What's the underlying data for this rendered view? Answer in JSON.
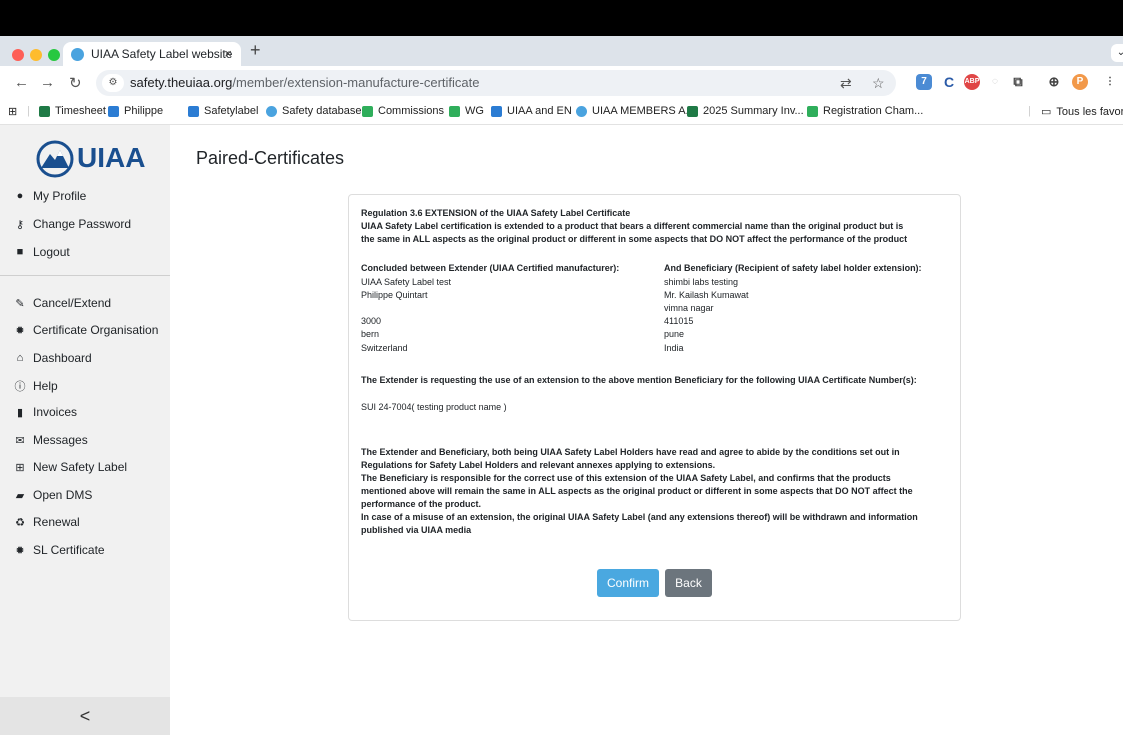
{
  "browser": {
    "tab_title": "UIAA Safety Label website",
    "tab_close": "×",
    "new_tab": "+",
    "url_host": "safety.theuiaa.org",
    "url_path": "/member/extension-manufacture-certificate",
    "profile_initial": "P",
    "bookmarks": [
      "Timesheet",
      "Philippe",
      "Safetylabel",
      "Safety database",
      "Commissions",
      "WG",
      "UIAA and EN",
      "UIAA MEMBERS A...",
      "2025 Summary Inv...",
      "Registration Cham..."
    ],
    "all_bookmarks": "Tous les favoris",
    "colors": {
      "tabbar": "#dde3ea",
      "accent": "#4aa8e0"
    }
  },
  "sidebar": {
    "logo_text": "UIAA",
    "account_items": [
      {
        "label": "My Profile",
        "icon": "user-icon"
      },
      {
        "label": "Change Password",
        "icon": "key-icon"
      },
      {
        "label": "Logout",
        "icon": "lock-icon"
      }
    ],
    "nav_items": [
      {
        "label": "Cancel/Extend",
        "icon": "edit-icon"
      },
      {
        "label": "Certificate Organisation",
        "icon": "certificate-icon"
      },
      {
        "label": "Dashboard",
        "icon": "home-icon"
      },
      {
        "label": "Help",
        "icon": "info-icon"
      },
      {
        "label": "Invoices",
        "icon": "file-icon"
      },
      {
        "label": "Messages",
        "icon": "envelope-icon"
      },
      {
        "label": "New Safety Label",
        "icon": "plus-square-icon"
      },
      {
        "label": "Open DMS",
        "icon": "folder-icon"
      },
      {
        "label": "Renewal",
        "icon": "recycle-icon"
      },
      {
        "label": "SL Certificate",
        "icon": "certificate-icon"
      }
    ],
    "collapse": "<"
  },
  "page": {
    "title": "Paired-Certificates",
    "regulation_title": "Regulation 3.6 EXTENSION of the UIAA Safety Label Certificate",
    "regulation_text_1": "UIAA Safety Label certification is extended to a product that bears a different commercial name than the original product but is",
    "regulation_text_2": "the same in ALL aspects as the original product or different in some aspects that DO NOT affect the performance of the product",
    "extender_heading": "Concluded between Extender (UIAA Certified manufacturer):",
    "extender": [
      "UIAA Safety Label test",
      "Philippe Quintart",
      "",
      "3000",
      "bern",
      "Switzerland"
    ],
    "beneficiary_heading": "And Beneficiary (Recipient of safety label holder extension):",
    "beneficiary": [
      "shimbi labs testing",
      "Mr. Kailash Kumawat",
      "vimna nagar",
      "411015",
      "pune",
      "India"
    ],
    "request_text": "The Extender is requesting the use of an extension to the above mention Beneficiary for the following UIAA Certificate Number(s):",
    "certificate_number": "SUI 24-7004( testing product name )",
    "terms": [
      "The Extender and Beneficiary, both being UIAA Safety Label Holders have read and agree to abide by the conditions set out in",
      "Regulations for Safety Label Holders and relevant annexes applying to extensions.",
      "The Beneficiary is responsible for the correct use of this extension of the UIAA Safety Label, and confirms that the products",
      "mentioned above will remain the same in ALL aspects as the original product or different in some aspects that DO NOT affect the",
      "performance of the product.",
      "In case of a misuse of an extension, the original UIAA Safety Label (and any extensions thereof) will be withdrawn and information",
      "published via UIAA media"
    ],
    "confirm_label": "Confirm",
    "back_label": "Back"
  }
}
